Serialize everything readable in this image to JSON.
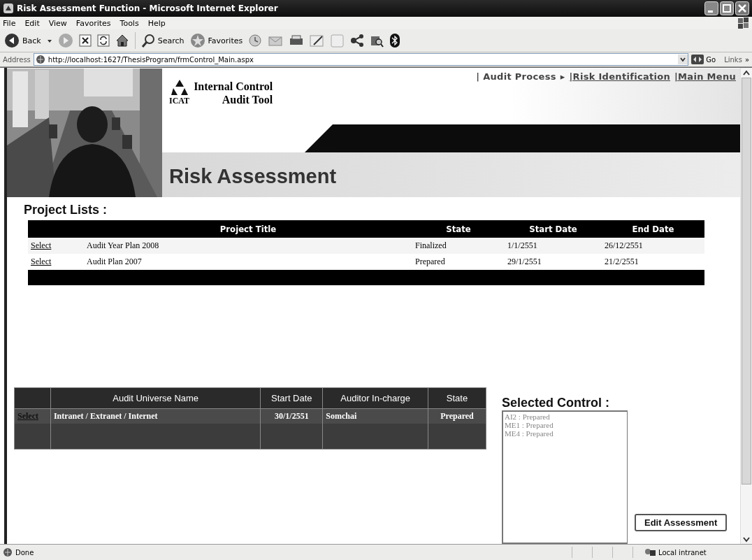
{
  "window": {
    "title": "Risk Assessment Function - Microsoft Internet Explorer"
  },
  "menu": [
    {
      "label": "File"
    },
    {
      "label": "Edit"
    },
    {
      "label": "View"
    },
    {
      "label": "Favorites"
    },
    {
      "label": "Tools"
    },
    {
      "label": "Help"
    }
  ],
  "toolbar": {
    "back": "Back",
    "search": "Search",
    "favorites": "Favorites"
  },
  "address": {
    "label": "Address",
    "url": "http://localhost:1627/ThesisProgram/frmControl_Main.aspx",
    "go": "Go",
    "links": "Links",
    "more": "»"
  },
  "nav": [
    {
      "kind": "text",
      "label": "| Audit Process"
    },
    {
      "kind": "arrow",
      "label": "▸"
    },
    {
      "kind": "link",
      "label": "|Risk Identification"
    },
    {
      "kind": "link",
      "label": "|Main Menu"
    }
  ],
  "logo": {
    "line1": "Internal Control",
    "line2": "Audit Tool",
    "abbr": "ICAT"
  },
  "page_title": "Risk Assessment",
  "project_lists": {
    "heading": "Project Lists :",
    "columns": [
      "Project Title",
      "State",
      "Start Date",
      "End Date"
    ],
    "rows": [
      {
        "action": "Select",
        "title": "Audit Year Plan 2008",
        "state": "Finalized",
        "start_date": "1/1/2551",
        "end_date": "26/12/2551"
      },
      {
        "action": "Select",
        "title": "Audit Plan 2007",
        "state": "Prepared",
        "start_date": "29/1/2551",
        "end_date": "21/2/2551"
      }
    ]
  },
  "audit_universe": {
    "columns": [
      "Audit Universe Name",
      "Start Date",
      "Auditor In-charge",
      "State"
    ],
    "rows": [
      {
        "action": "Select",
        "name": "Intranet / Extranet / Internet",
        "start_date": "30/1/2551",
        "auditor": "Somchai",
        "state": "Prepared"
      }
    ]
  },
  "selected_control": {
    "heading": "Selected Control :",
    "items": [
      "AI2 : Prepared",
      "ME1 : Prepared",
      "ME4 : Prepared"
    ]
  },
  "edit_button": "Edit Assessment",
  "status_bar": {
    "text": "Done",
    "zone": "Local intranet"
  }
}
